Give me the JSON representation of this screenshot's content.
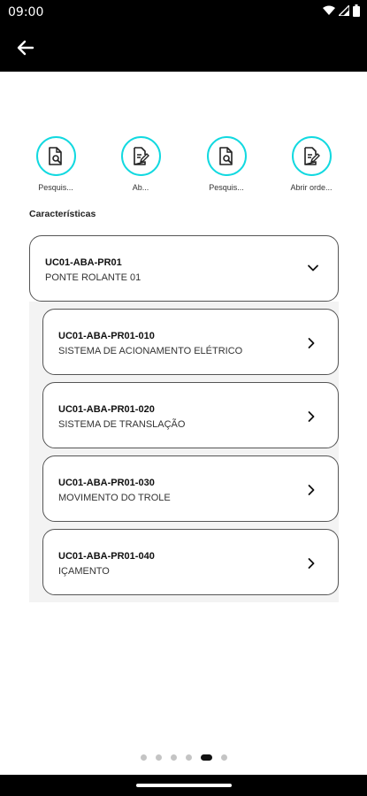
{
  "status": {
    "time": "09:00"
  },
  "actions": [
    {
      "label": "Pesquis...",
      "icon": "document-search-icon"
    },
    {
      "label": "Ab...",
      "icon": "document-edit-icon"
    },
    {
      "label": "Pesquis...",
      "icon": "document-search-icon"
    },
    {
      "label": "Abrir orde...",
      "icon": "document-edit-icon"
    }
  ],
  "section_title": "Características",
  "parent": {
    "code": "UC01-ABA-PR01",
    "name": "PONTE ROLANTE 01"
  },
  "children": [
    {
      "code": "UC01-ABA-PR01-010",
      "name": "SISTEMA DE ACIONAMENTO ELÉTRICO"
    },
    {
      "code": "UC01-ABA-PR01-020",
      "name": "SISTEMA DE TRANSLAÇÃO"
    },
    {
      "code": "UC01-ABA-PR01-030",
      "name": "MOVIMENTO DO TROLE"
    },
    {
      "code": "UC01-ABA-PR01-040",
      "name": "IÇAMENTO"
    }
  ],
  "pager": {
    "total": 6,
    "active": 5
  },
  "colors": {
    "accent": "#12d9e0",
    "bar": "#000000"
  }
}
